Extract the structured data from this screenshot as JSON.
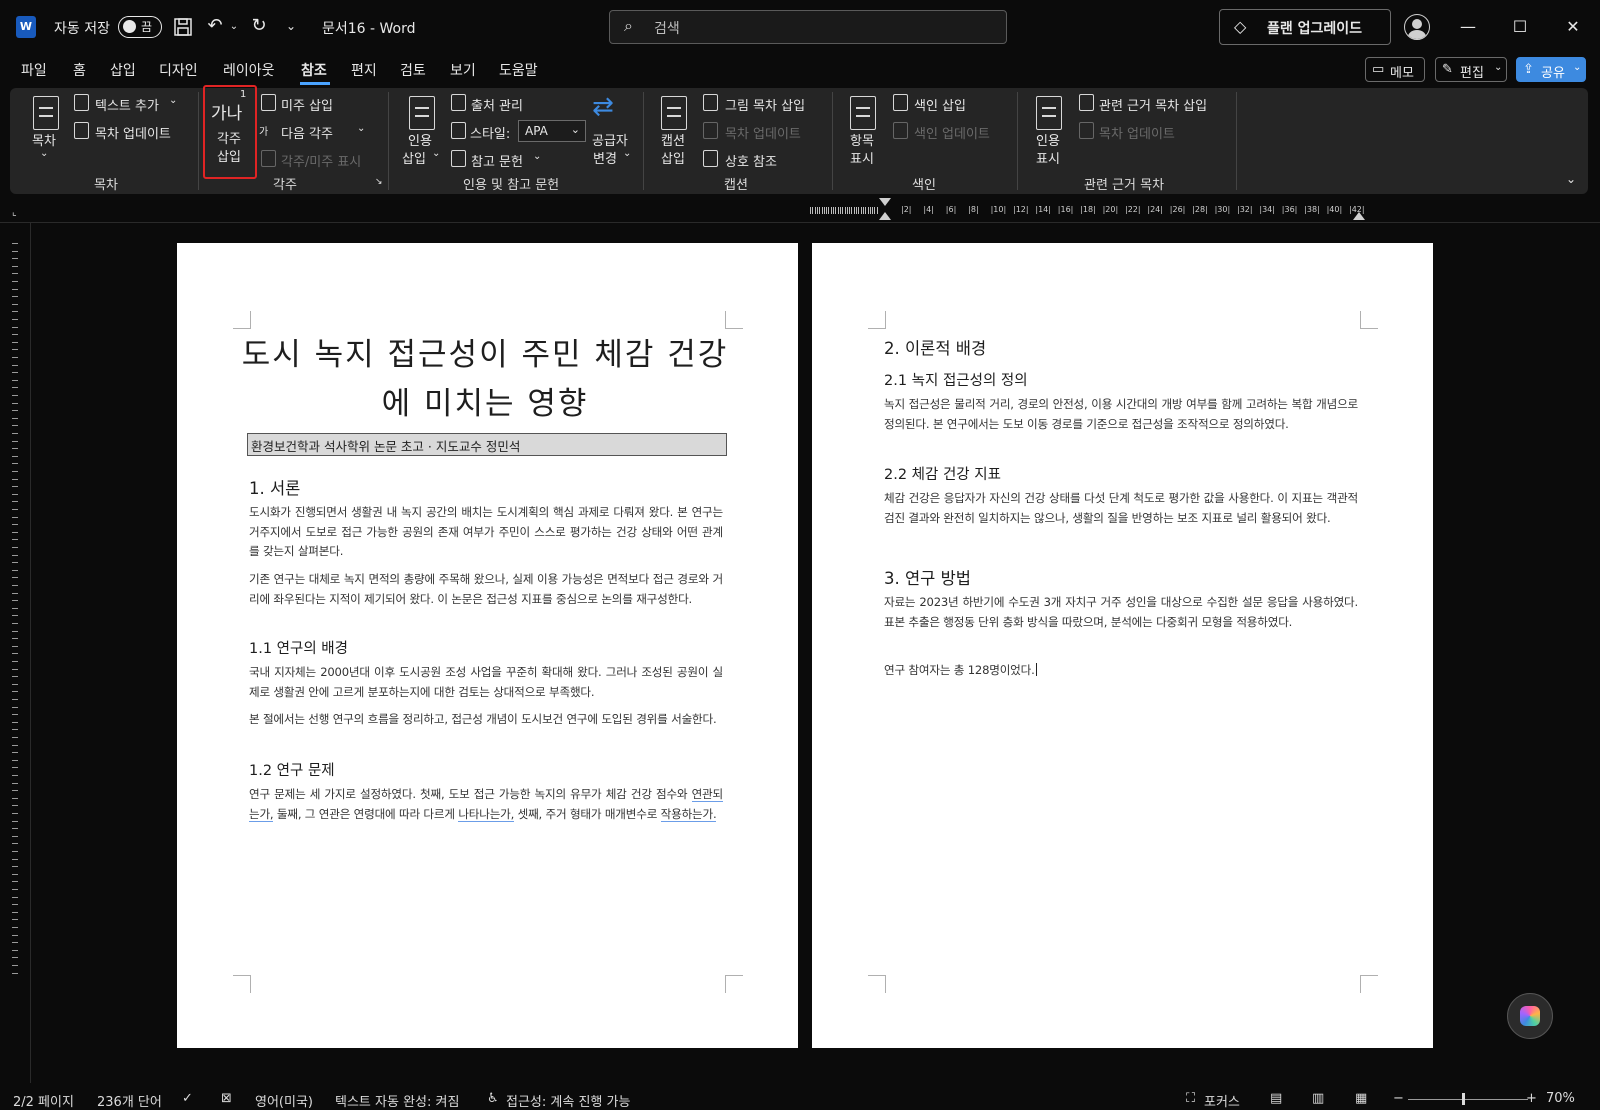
{
  "titlebar": {
    "autosave_label": "자동 저장",
    "autosave_state": "끔",
    "doc_title": "문서16  -  Word",
    "search_placeholder": "검색",
    "upgrade_label": "플랜 업그레이드"
  },
  "menu": {
    "tabs": [
      "파일",
      "홈",
      "삽입",
      "디자인",
      "레이아웃",
      "참조",
      "편지",
      "검토",
      "보기",
      "도움말"
    ],
    "active_tab": "참조",
    "memo_label": "메모",
    "edit_label": "편집",
    "share_label": "공유"
  },
  "ribbon": {
    "toc": {
      "big_label": "목차",
      "add_text": "텍스트 추가",
      "update_toc": "목차 업데이트",
      "group": "목차"
    },
    "footnotes": {
      "insert_footnote_icon": "가나",
      "insert_footnote_label_1": "각주",
      "insert_footnote_label_2": "삽입",
      "insert_endnote": "미주 삽입",
      "next_footnote": "다음 각주",
      "show_notes": "각주/미주 표시",
      "group": "각주"
    },
    "citations": {
      "insert_citation_1": "인용",
      "insert_citation_2": "삽입",
      "manage_sources": "출처 관리",
      "style_label": "스타일:",
      "style_value": "APA",
      "bibliography": "참고 문헌",
      "provider_1": "공급자",
      "provider_2": "변경",
      "group": "인용 및 참고 문헌"
    },
    "captions": {
      "insert_caption_1": "캡션",
      "insert_caption_2": "삽입",
      "insert_tof": "그림 목차 삽입",
      "update_table": "목차 업데이트",
      "cross_reference": "상호 참조",
      "group": "캡션"
    },
    "index": {
      "mark_entry_1": "항목",
      "mark_entry_2": "표시",
      "insert_index": "색인 삽입",
      "update_index": "색인 업데이트",
      "group": "색인"
    },
    "toa": {
      "mark_citation_1": "인용",
      "mark_citation_2": "표시",
      "insert_toa": "관련 근거 목차 삽입",
      "update_table": "목차 업데이트",
      "group": "관련 근거 목차"
    }
  },
  "ruler": {
    "numbers": [
      "2",
      "4",
      "6",
      "8",
      "10",
      "12",
      "14",
      "16",
      "18",
      "20",
      "22",
      "24",
      "26",
      "28",
      "30",
      "32",
      "34",
      "36",
      "38",
      "40",
      "42"
    ]
  },
  "page1": {
    "title_line1": "도시 녹지 접근성이 주민 체감 건강",
    "title_line2": "에 미치는 영향",
    "subtitle": "환경보건학과 석사학위 논문 초고 · 지도교수 정민석",
    "h_intro": "1. 서론",
    "p1": "도시화가 진행되면서 생활권 내 녹지 공간의 배치는 도시계획의 핵심 과제로 다뤄져 왔다. 본 연구는 거주지에서 도보로 접근 가능한 공원의 존재 여부가 주민이 스스로 평가하는 건강 상태와 어떤 관계를 갖는지 살펴본다.",
    "p2": "기존 연구는 대체로 녹지 면적의 총량에 주목해 왔으나, 실제 이용 가능성은 면적보다 접근 경로와 거리에 좌우된다는 지적이 제기되어 왔다. 이 논문은 접근성 지표를 중심으로 논의를 재구성한다.",
    "h_bg": "1.1 연구의 배경",
    "p3": "국내 지자체는 2000년대 이후 도시공원 조성 사업을 꾸준히 확대해 왔다. 그러나 조성된 공원이 실제로 생활권 안에 고르게 분포하는지에 대한 검토는 상대적으로 부족했다.",
    "p4": "본 절에서는 선행 연구의 흐름을 정리하고, 접근성 개념이 도시보건 연구에 도입된 경위를 서술한다.",
    "h_rq": "1.2 연구 문제",
    "p5_a": "연구 문제는 세 가지로 설정하였다. 첫째, 도보 접근 가능한 녹지의 유무가 체감 건강 점수와 ",
    "p5_u1": "연관되는가,",
    "p5_b": " 둘째, 그 연관은 연령대에 따라 다르게 ",
    "p5_u2": "나타나는가,",
    "p5_c": " 셋째, 주거 형태가 매개변수로 ",
    "p5_u3": "작용하는가."
  },
  "page2": {
    "h_theory": "2. 이론적 배경",
    "h_def": "2.1 녹지 접근성의 정의",
    "p1": "녹지 접근성은 물리적 거리, 경로의 안전성, 이용 시간대의 개방 여부를 함께 고려하는 복합 개념으로 정의된다. 본 연구에서는 도보 이동 경로를 기준으로 접근성을 조작적으로 정의하였다.",
    "h_health": "2.2 체감 건강 지표",
    "p2": "체감 건강은 응답자가 자신의 건강 상태를 다섯 단계 척도로 평가한 값을 사용한다. 이 지표는 객관적 검진 결과와 완전히 일치하지는 않으나, 생활의 질을 반영하는 보조 지표로 널리 활용되어 왔다.",
    "h_method": "3. 연구 방법",
    "p3": "자료는 2023년 하반기에 수도권 3개 자치구 거주 성인을 대상으로 수집한 설문 응답을 사용하였다. 표본 추출은 행정동 단위 층화 방식을 따랐으며, 분석에는 다중회귀 모형을 적용하였다.",
    "p4": "연구 참여자는 총 128명이었다."
  },
  "status": {
    "pages": "2/2 페이지",
    "words": "236개 단어",
    "language": "영어(미국)",
    "autocomplete": "텍스트 자동 완성: 켜짐",
    "accessibility": "접근성: 계속 진행 가능",
    "focus": "포커스",
    "zoom": "70%"
  },
  "colors": {
    "accent": "#4aa3ff",
    "share_bg": "#3d8ae0",
    "highlight": "#e02424",
    "word_blue": "#185abd"
  }
}
